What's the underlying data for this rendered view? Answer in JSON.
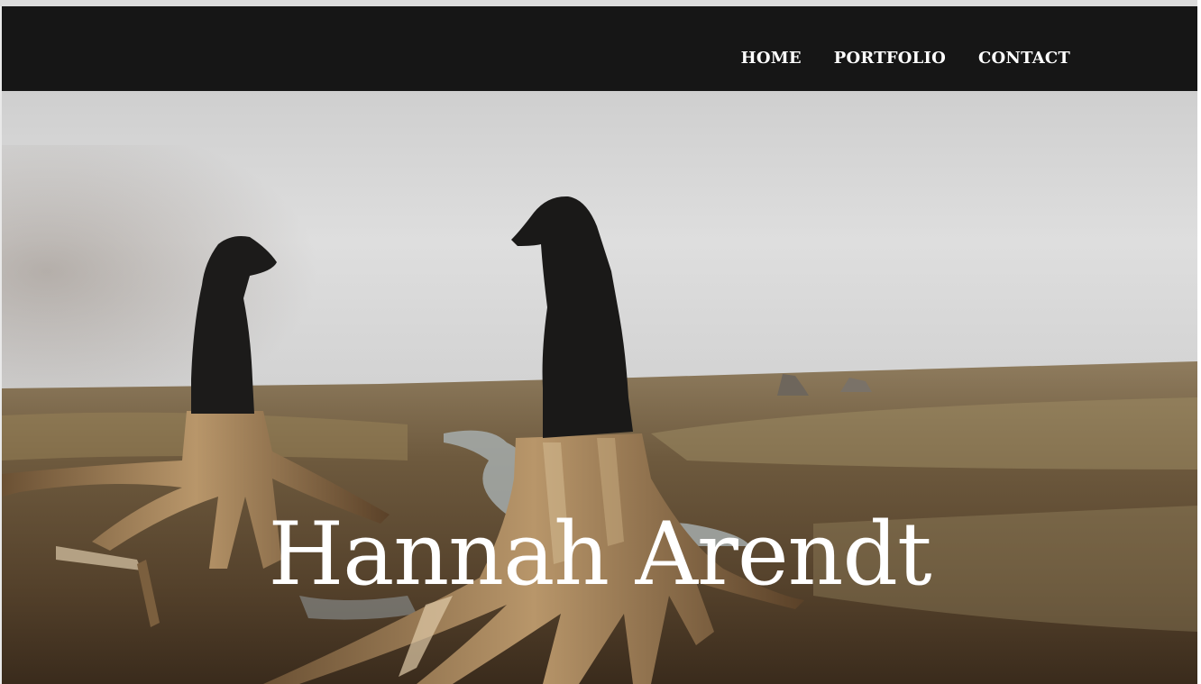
{
  "nav": {
    "items": [
      {
        "label": "HOME"
      },
      {
        "label": "PORTFOLIO"
      },
      {
        "label": "CONTACT"
      }
    ]
  },
  "hero": {
    "title": "Hannah Arendt",
    "image_description_icon": "landscape-photo"
  },
  "colors": {
    "navbar": "#161616",
    "nav_text": "#ffffff",
    "title_text": "#ffffff"
  }
}
